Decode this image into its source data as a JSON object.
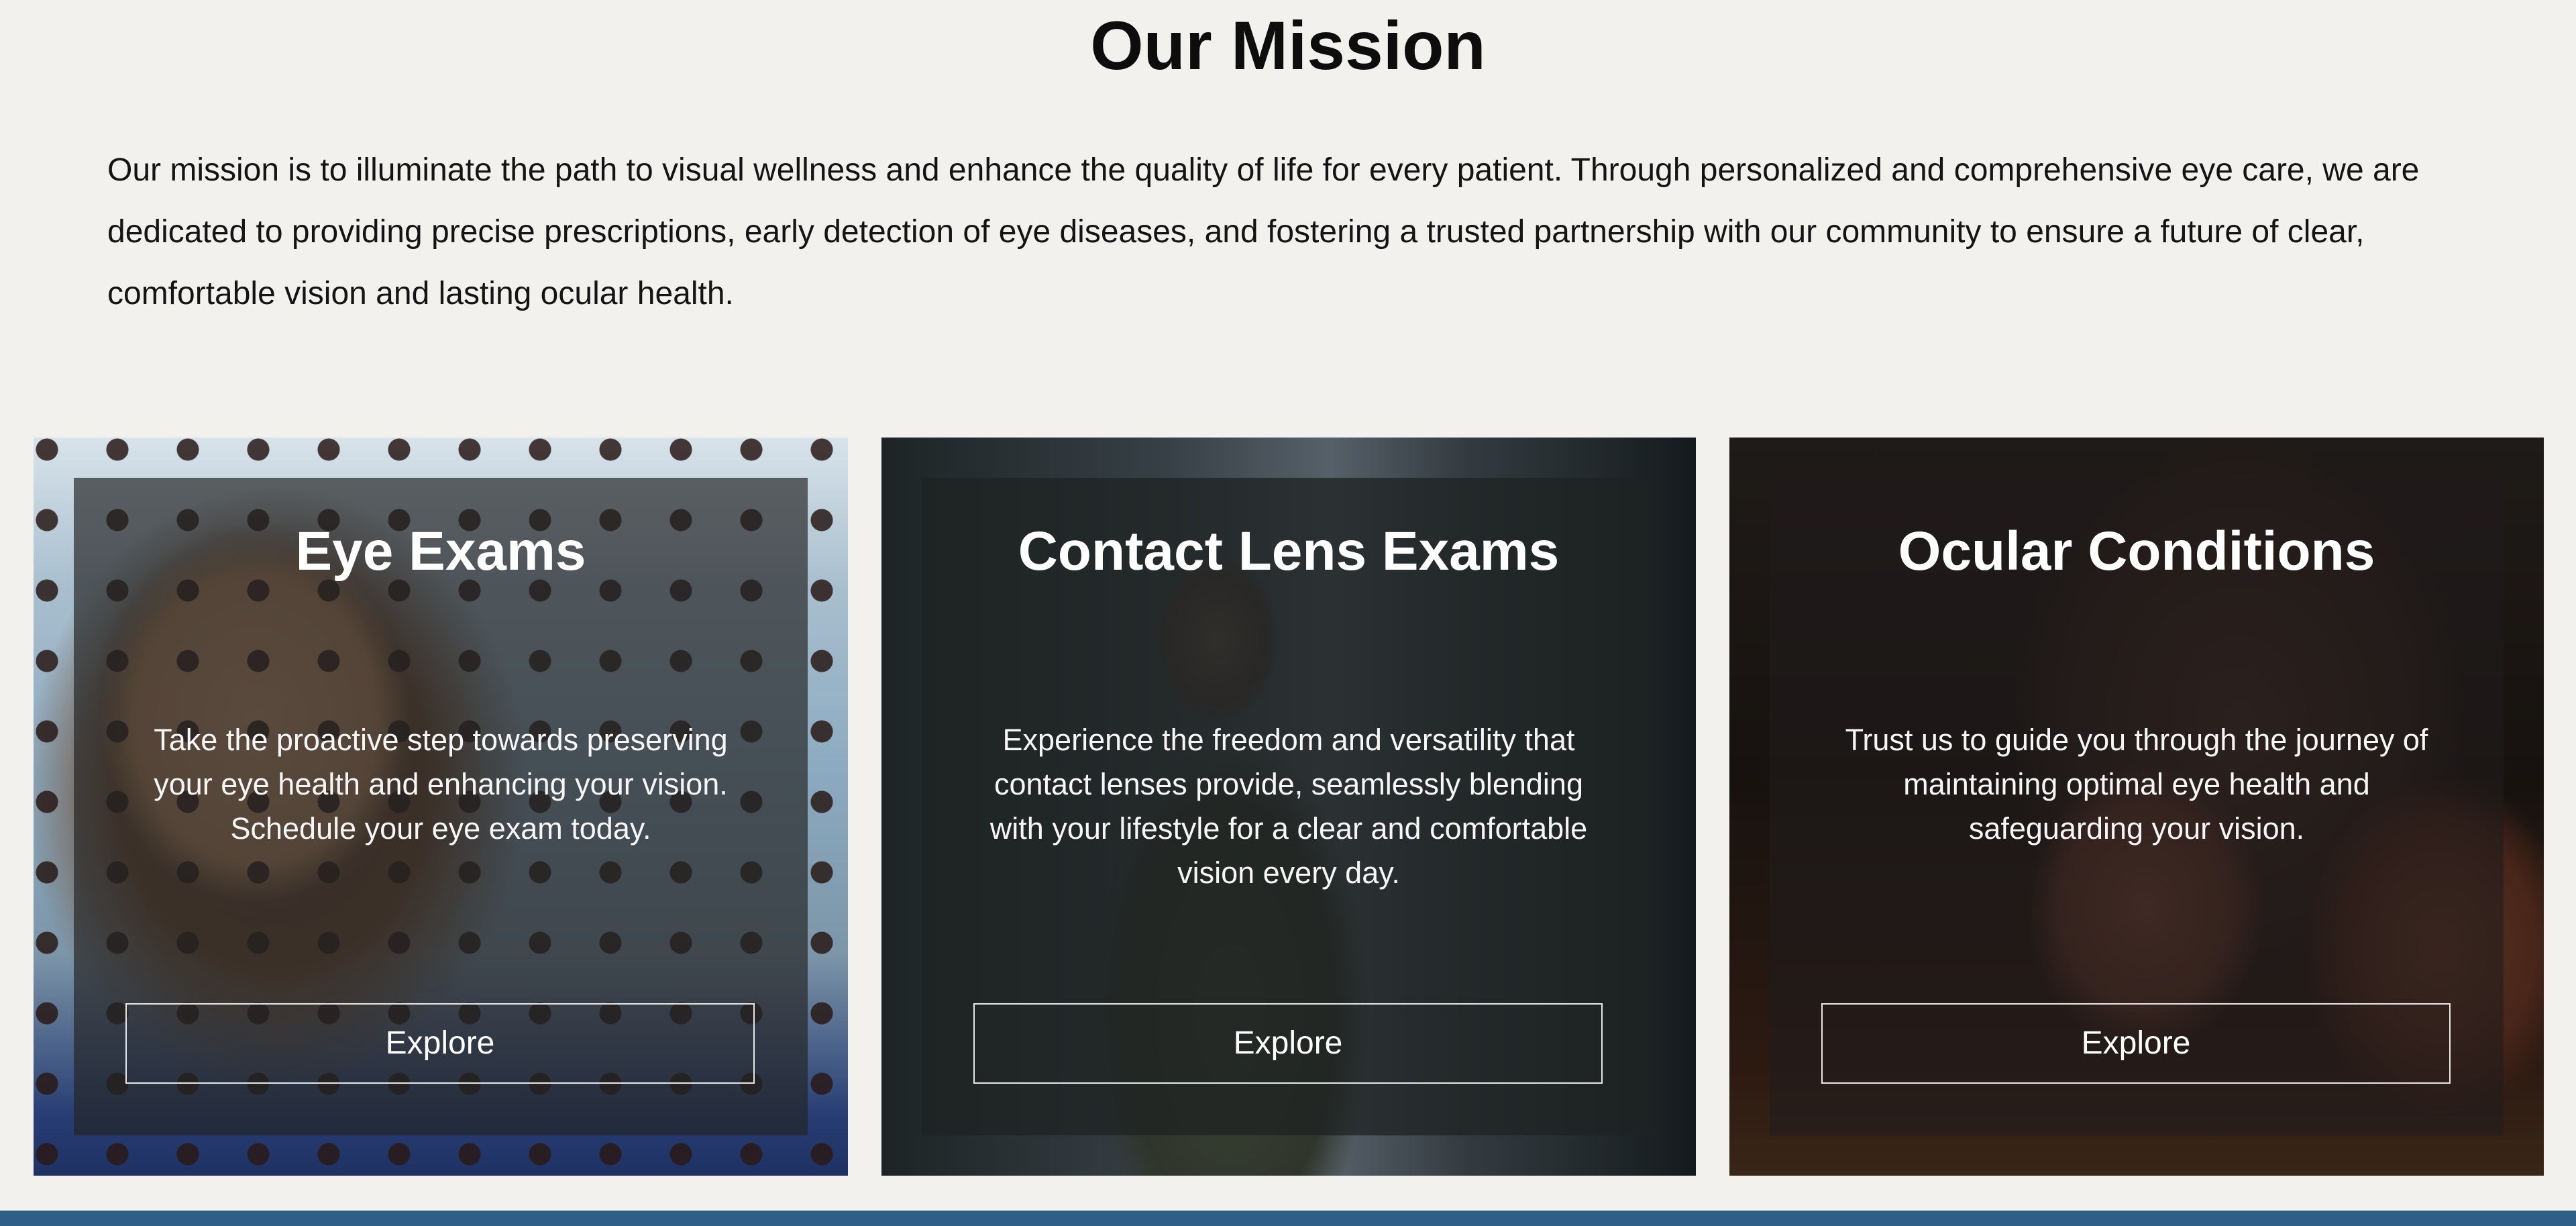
{
  "mission": {
    "title": "Our Mission",
    "text": "Our mission is to illuminate the path to visual wellness and enhance the quality of life for every patient. Through personalized and comprehensive eye care, we are dedicated to providing precise prescriptions, early detection of eye diseases, and fostering a trusted partnership with our community to ensure a future of clear, comfortable vision and lasting ocular health."
  },
  "cards": [
    {
      "title": "Eye Exams",
      "text": "Take the proactive step towards preserving your eye health and enhancing your vision. Schedule your eye exam today.",
      "button_label": "Explore"
    },
    {
      "title": "Contact Lens Exams",
      "text": "Experience the freedom and versatility that contact lenses provide, seamlessly blending with your lifestyle for a clear and comfortable vision every day.",
      "button_label": "Explore"
    },
    {
      "title": "Ocular Conditions",
      "text": "Trust us to guide you through the journey of maintaining optimal eye health and safeguarding your vision.",
      "button_label": "Explore"
    }
  ],
  "colors": {
    "background": "#f2f1ed",
    "footer_band": "#2f5f86",
    "overlay": "#1e2020",
    "text_on_card": "#ffffff"
  }
}
